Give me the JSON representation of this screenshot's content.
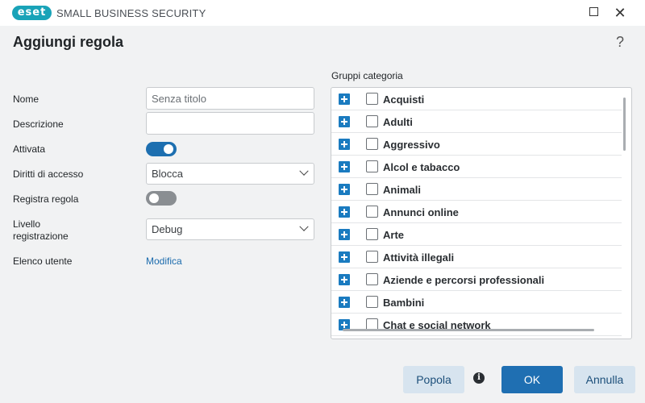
{
  "titlebar": {
    "logo_text": "eset",
    "app_name": "SMALL BUSINESS SECURITY",
    "maximize_icon": "maximize-icon",
    "close_glyph": "✕"
  },
  "dialog": {
    "title": "Aggiungi regola",
    "help_glyph": "?"
  },
  "form": {
    "name_label": "Nome",
    "name_value": "Senza titolo",
    "description_label": "Descrizione",
    "description_value": "",
    "enabled_label": "Attivata",
    "enabled": true,
    "access_label": "Diritti di accesso",
    "access_value": "Blocca",
    "log_rule_label": "Registra regola",
    "log_rule": false,
    "log_level_label": "Livello\nregistrazione",
    "log_level_value": "Debug",
    "user_list_label": "Elenco utente",
    "user_list_link": "Modifica"
  },
  "groups": {
    "label": "Gruppi categoria",
    "items": [
      {
        "label": "Acquisti",
        "checked": false
      },
      {
        "label": "Adulti",
        "checked": false
      },
      {
        "label": "Aggressivo",
        "checked": false
      },
      {
        "label": "Alcol e tabacco",
        "checked": false
      },
      {
        "label": "Animali",
        "checked": false
      },
      {
        "label": "Annunci online",
        "checked": false
      },
      {
        "label": "Arte",
        "checked": false
      },
      {
        "label": "Attività illegali",
        "checked": false
      },
      {
        "label": "Aziende e percorsi professionali",
        "checked": false
      },
      {
        "label": "Bambini",
        "checked": false
      },
      {
        "label": "Chat e social network",
        "checked": false
      }
    ]
  },
  "footer": {
    "populate_label": "Popola",
    "info_glyph": "i",
    "ok_label": "OK",
    "cancel_label": "Annulla"
  },
  "colors": {
    "accent": "#1f6fb2",
    "brand": "#19a3b8",
    "toggle_on": "#1d6fb0",
    "toggle_off": "#8a8e92"
  }
}
